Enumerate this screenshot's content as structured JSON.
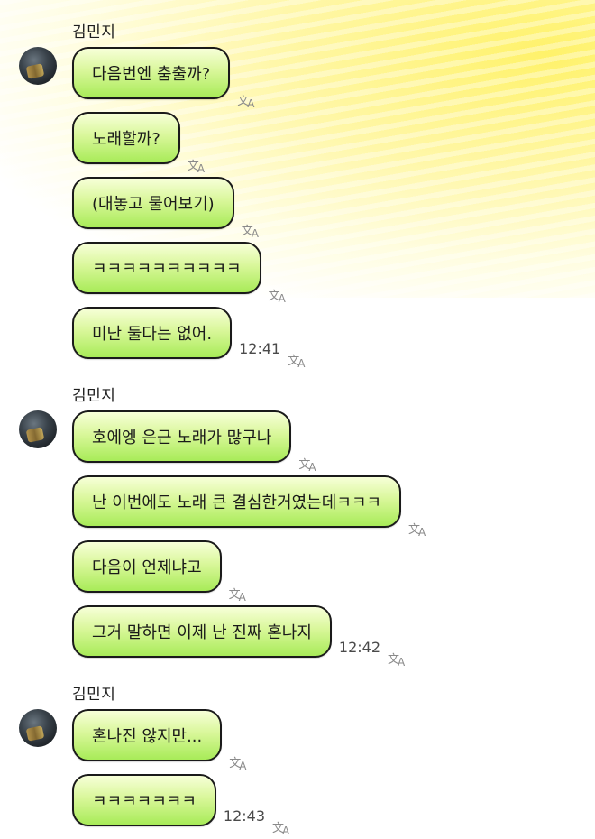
{
  "translate_icon": {
    "glyph": "文",
    "letter": "A"
  },
  "groups": [
    {
      "sender": "김민지",
      "messages": [
        {
          "text": "다음번엔 춤출까?",
          "time": ""
        },
        {
          "text": "노래할까?",
          "time": ""
        },
        {
          "text": "(대놓고 물어보기)",
          "time": ""
        },
        {
          "text": "ㅋㅋㅋㅋㅋㅋㅋㅋㅋㅋ",
          "time": ""
        },
        {
          "text": "미난 둘다는 없어.",
          "time": "12:41"
        }
      ]
    },
    {
      "sender": "김민지",
      "messages": [
        {
          "text": "호에엥 은근 노래가 많구나",
          "time": ""
        },
        {
          "text": "난 이번에도 노래 큰 결심한거였는데ㅋㅋㅋ",
          "time": ""
        },
        {
          "text": "다음이 언제냐고",
          "time": ""
        },
        {
          "text": "그거 말하면 이제 난 진짜 혼나지",
          "time": "12:42"
        }
      ]
    },
    {
      "sender": "김민지",
      "messages": [
        {
          "text": "혼나진 않지만...",
          "time": ""
        },
        {
          "text": "ㅋㅋㅋㅋㅋㅋㅋ",
          "time": "12:43"
        }
      ]
    }
  ]
}
